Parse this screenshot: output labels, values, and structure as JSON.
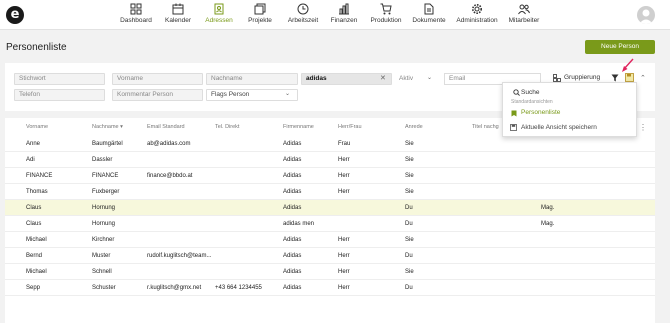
{
  "nav": {
    "logo": "e",
    "items": [
      {
        "label": "Dashboard",
        "icon": "dashboard-icon"
      },
      {
        "label": "Kalender",
        "icon": "calendar-icon"
      },
      {
        "label": "Adressen",
        "icon": "addressbook-icon",
        "active": true
      },
      {
        "label": "Projekte",
        "icon": "projects-icon"
      },
      {
        "label": "Arbeitszeit",
        "icon": "clock-icon"
      },
      {
        "label": "Finanzen",
        "icon": "finance-icon"
      },
      {
        "label": "Produktion",
        "icon": "cart-icon"
      },
      {
        "label": "Dokumente",
        "icon": "documents-icon"
      },
      {
        "label": "Administration",
        "icon": "gear-icon"
      },
      {
        "label": "Mitarbeiter",
        "icon": "users-icon"
      }
    ]
  },
  "page": {
    "title": "Personenliste",
    "new_button": "Neue Person"
  },
  "filters": {
    "stichwort": "Stichwort",
    "vorname": "Vorname",
    "nachname": "Nachname",
    "firma_value": "adidas",
    "aktiv": "Aktiv",
    "email": "Email",
    "telefon": "Telefon",
    "kommentar": "Kommentar Person",
    "flags": "Flags Person",
    "gruppierung": "Gruppierung"
  },
  "dropdown": {
    "search_placeholder": "Suche",
    "section": "Standardansichten",
    "item_selected": "Personenliste",
    "save_label": "Aktuelle Ansicht speichern"
  },
  "table": {
    "columns": [
      "Vorname",
      "Nachname ▾",
      "Email Standard",
      "Tel. Direkt",
      "Firmenname",
      "Herr/Frau",
      "Anrede",
      "Titel nachg"
    ],
    "rows": [
      [
        "Anne",
        "Baumgärtel",
        "ab@adidas.com",
        "",
        "Adidas",
        "Frau",
        "Sie",
        ""
      ],
      [
        "Adi",
        "Dassler",
        "",
        "",
        "Adidas",
        "Herr",
        "Sie",
        ""
      ],
      [
        "FINANCE",
        "FINANCE",
        "finance@bbdo.at",
        "",
        "Adidas",
        "Herr",
        "Sie",
        ""
      ],
      [
        "Thomas",
        "Fuxberger",
        "",
        "",
        "Adidas",
        "Herr",
        "Sie",
        ""
      ],
      [
        "Claus",
        "Hornung",
        "",
        "",
        "Adidas",
        "",
        "Du",
        "Mag."
      ],
      [
        "Claus",
        "Hornung",
        "",
        "",
        "adidas men",
        "",
        "Du",
        "Mag."
      ],
      [
        "Michael",
        "Kirchner",
        "",
        "",
        "Adidas",
        "Herr",
        "Sie",
        ""
      ],
      [
        "Bernd",
        "Muster",
        "rudolf.kuglitsch@team...",
        "",
        "Adidas",
        "Herr",
        "Du",
        ""
      ],
      [
        "Michael",
        "Schnell",
        "",
        "",
        "Adidas",
        "Herr",
        "Sie",
        ""
      ],
      [
        "Sepp",
        "Schuster",
        "r.kuglitsch@gmx.net",
        "+43 664 1234455",
        "Adidas",
        "Herr",
        "Du",
        ""
      ]
    ],
    "highlighted_row": 4
  },
  "colors": {
    "accent": "#7a9a1a",
    "highlight": "#f7f8dc"
  }
}
